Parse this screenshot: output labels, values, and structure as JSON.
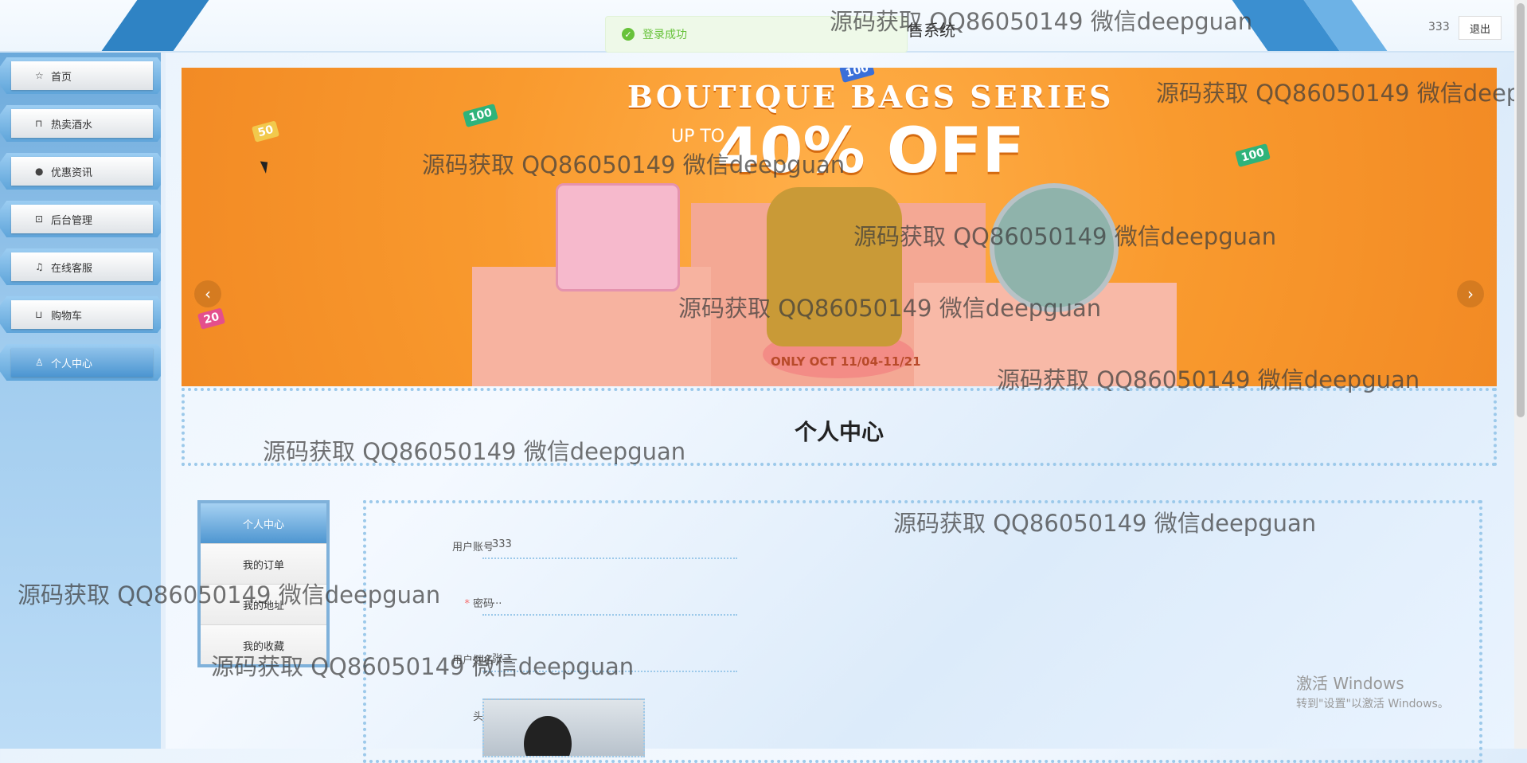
{
  "header": {
    "site_title_partial": "售系统",
    "toast_message": "登录成功",
    "username": "333",
    "logout_label": "退出"
  },
  "sidebar": {
    "items": [
      {
        "label": "首页",
        "icon": "star-icon"
      },
      {
        "label": "热卖酒水",
        "icon": "bag-icon"
      },
      {
        "label": "优惠资讯",
        "icon": "info-icon"
      },
      {
        "label": "后台管理",
        "icon": "briefcase-icon"
      },
      {
        "label": "在线客服",
        "icon": "headset-icon"
      },
      {
        "label": "购物车",
        "icon": "cart-icon"
      },
      {
        "label": "个人中心",
        "icon": "user-icon"
      }
    ],
    "active_index": 6
  },
  "banner": {
    "headline_top": "BOUTIQUE BAGS SERIES",
    "up_to": "UP TO",
    "headline_main": "40% OFF",
    "promo_line": "ONLY OCT 11/04-11/21",
    "confetti": [
      "50",
      "100",
      "100",
      "100",
      "20"
    ]
  },
  "section": {
    "title": "个人中心"
  },
  "submenu": {
    "items": [
      "个人中心",
      "我的订单",
      "我的地址",
      "我的收藏"
    ]
  },
  "form": {
    "account_label": "用户账号",
    "account_value": "333",
    "password_label": "密码",
    "password_value": "...",
    "name_label": "用户姓名",
    "name_value": "张三",
    "avatar_label": "头像"
  },
  "watermark": {
    "text": "源码获取 QQ86050149 微信deepguan"
  },
  "windows_activation": {
    "line1": "激活 Windows",
    "line2": "转到\"设置\"以激活 Windows。"
  },
  "colors": {
    "accent": "#2f83c4",
    "success": "#67c23a",
    "banner_orange": "#f99a2e"
  }
}
